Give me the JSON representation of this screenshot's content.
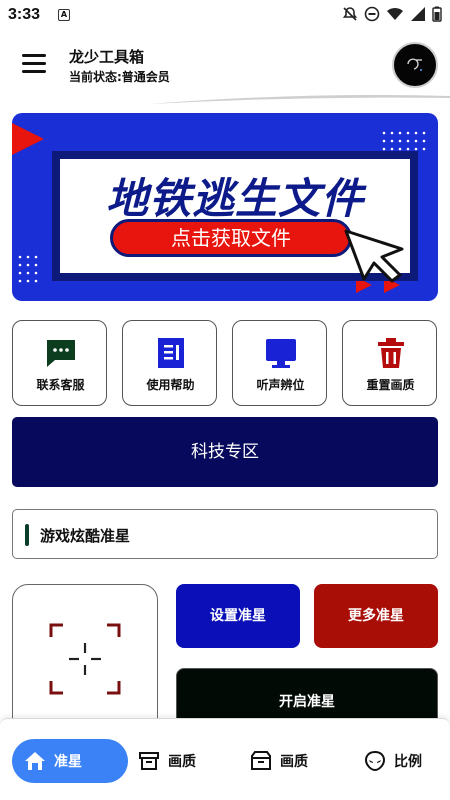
{
  "status_bar": {
    "time": "3:33",
    "notification_badge": "A"
  },
  "header": {
    "title": "龙少工具箱",
    "status": "当前状态:普通会员"
  },
  "banner": {
    "title": "地铁逃生文件",
    "button": "点击获取文件"
  },
  "quick_actions": [
    {
      "label": "联系客服",
      "icon": "chat-icon",
      "color": "#0b3d1e"
    },
    {
      "label": "使用帮助",
      "icon": "help-doc-icon",
      "color": "#1a22d6"
    },
    {
      "label": "听声辨位",
      "icon": "monitor-icon",
      "color": "#1a22d6"
    },
    {
      "label": "重置画质",
      "icon": "trash-icon",
      "color": "#b50d0d"
    }
  ],
  "tech_zone": {
    "label": "科技专区"
  },
  "section": {
    "title": "游戏炫酷准星"
  },
  "crosshair": {
    "set_label": "设置准星",
    "more_label": "更多准星",
    "open_label": "开启准星"
  },
  "bottom_nav": [
    {
      "label": "准星",
      "icon": "home-icon",
      "active": true
    },
    {
      "label": "画质",
      "icon": "box-icon",
      "active": false
    },
    {
      "label": "画质",
      "icon": "archive-icon",
      "active": false
    },
    {
      "label": "比例",
      "icon": "alien-icon",
      "active": false
    }
  ],
  "colors": {
    "banner_bg": "#1a2fd6",
    "banner_accent": "#e8140e",
    "tech_bg": "#070a5c",
    "set_btn": "#0a0fb8",
    "more_btn": "#a80d06",
    "open_btn": "#020a06",
    "nav_active": "#3b82f6"
  }
}
